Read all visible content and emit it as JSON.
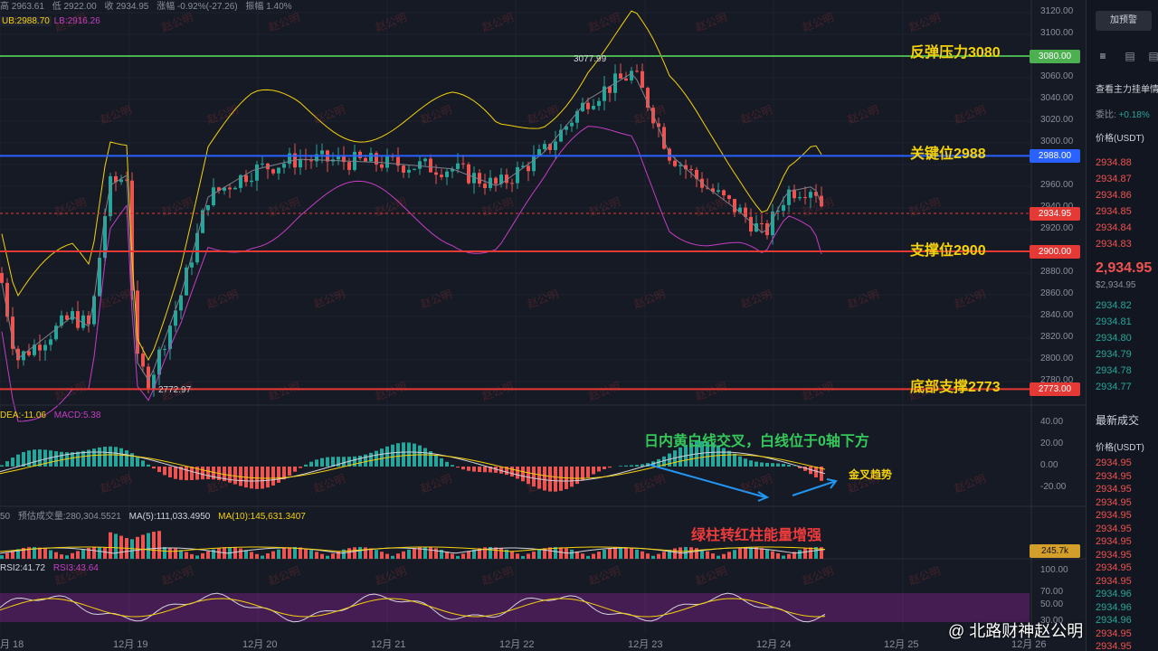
{
  "header": {
    "high": "高 2963.61",
    "low": "低 2922.00",
    "close": "收 2934.95",
    "change": "涨幅 -0.92%(-27.26)",
    "amplitude": "振幅 1.40%",
    "ub": "UB:2988.70",
    "lb": "LB:2916.26"
  },
  "price_axis": {
    "labels": [
      "3120.00",
      "3100.00",
      "3060.00",
      "3040.00",
      "3020.00",
      "3000.00",
      "2960.00",
      "2940.00",
      "2920.00",
      "2880.00",
      "2860.00",
      "2840.00",
      "2820.00",
      "2800.00",
      "2780.00"
    ],
    "tags": [
      {
        "text": "3080.00",
        "color": "#4caf50"
      },
      {
        "text": "2988.00",
        "color": "#2962ff"
      },
      {
        "text": "2934.95",
        "color": "#e53935"
      },
      {
        "text": "2900.00",
        "color": "#e53935"
      },
      {
        "text": "2773.00",
        "color": "#e53935"
      }
    ]
  },
  "levels": {
    "resistance": "反弹压力3080",
    "key": "关键位2988",
    "support": "支撑位2900",
    "bottom": "底部支撑2773"
  },
  "chart_marks": {
    "high": "3077.99",
    "low": "2772.97"
  },
  "macd": {
    "dea": "DEA:-11.06",
    "macd": "MACD:5.38",
    "axis": [
      "40.00",
      "20.00",
      "0.00",
      "-20.00"
    ],
    "note": "日内黄白线交叉，白线位于0轴下方",
    "golden": "金叉趋势"
  },
  "volume": {
    "legend_a": "50",
    "legend_b": "预估成交量:280,304.5521",
    "ma5": "MA(5):111,033.4950",
    "ma10": "MA(10):145,631.3407",
    "tag": "245.7k",
    "note": "绿柱转红柱能量增强"
  },
  "rsi": {
    "rsi2": "RSI2:41.72",
    "rsi3": "RSI3:43.64",
    "axis": [
      "100.00",
      "70.00",
      "50.00",
      "30.00"
    ]
  },
  "dates": [
    "月 18",
    "12月 19",
    "12月 20",
    "12月 21",
    "12月 22",
    "12月 23",
    "12月 24",
    "12月 25",
    "12月 26"
  ],
  "right_panel": {
    "button": "加预警",
    "view": "查看主力挂单情",
    "ratio_label": "委比:",
    "ratio_value": "+0.18%",
    "price_header": "价格(USDT)",
    "asks": [
      "2934.88",
      "2934.87",
      "2934.86",
      "2934.85",
      "2934.84",
      "2934.83"
    ],
    "last": "2,934.95",
    "last_sub": "$2,934.95",
    "bids": [
      "2934.82",
      "2934.81",
      "2934.80",
      "2934.79",
      "2934.78",
      "2934.77"
    ],
    "trades_title": "最新成交",
    "trades_header": "价格(USDT)",
    "trades": [
      "2934.95",
      "2934.95",
      "2934.95",
      "2934.95",
      "2934.95",
      "2934.95",
      "2934.95",
      "2934.95",
      "2934.95",
      "2934.95",
      "2934.96",
      "2934.96",
      "2934.96",
      "2934.95",
      "2934.95"
    ]
  },
  "watermark": "赵公明",
  "social": "@ 北路财神赵公明",
  "colors": {
    "up": "#26a69a",
    "down": "#ef5350",
    "yellow": "#f5d20a",
    "blue": "#2962ff",
    "green": "#4caf50",
    "red": "#e53935"
  }
}
